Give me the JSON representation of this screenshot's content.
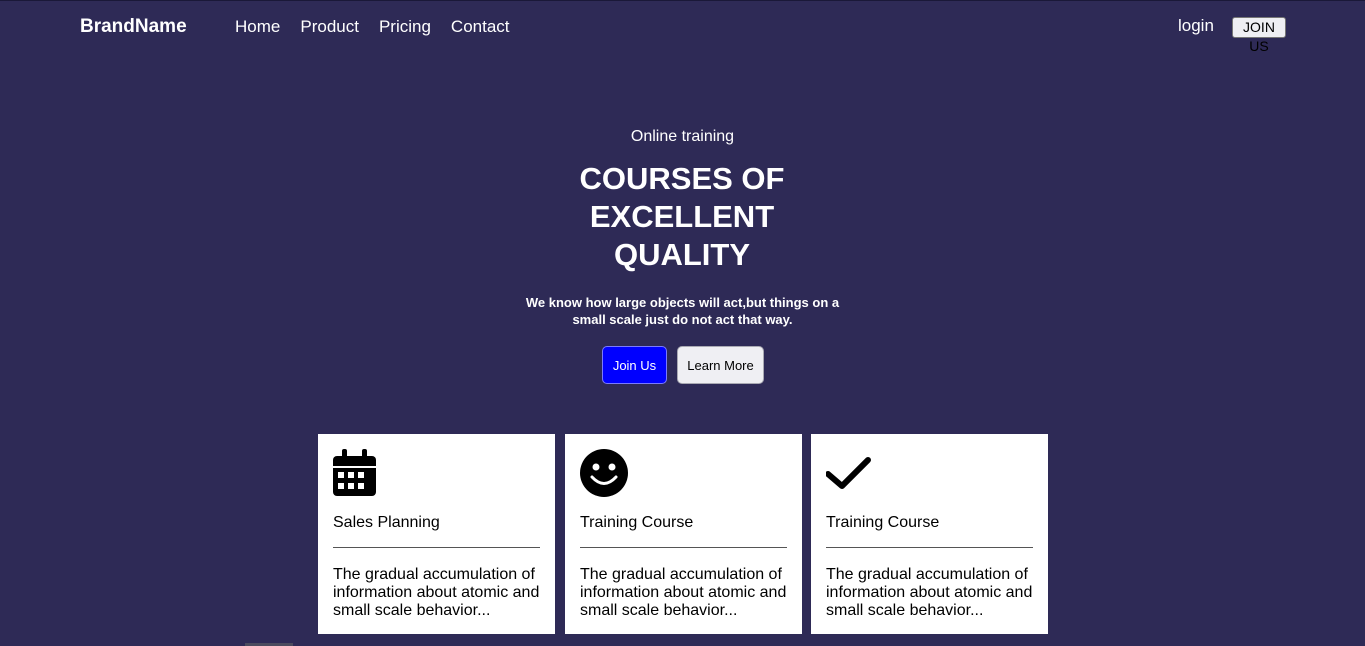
{
  "nav": {
    "brand": "BrandName",
    "links": [
      "Home",
      "Product",
      "Pricing",
      "Contact"
    ],
    "login": "login",
    "join": "JOIN US"
  },
  "hero": {
    "eyebrow": "Online training",
    "headline": "COURSES OF EXCELLENT QUALITY",
    "subtext": "We know how large objects will act,but things on a small scale just do not act that way.",
    "primary_button": "Join Us",
    "secondary_button": "Learn More"
  },
  "cards": [
    {
      "icon": "calendar-icon",
      "title": "Sales Planning",
      "desc": "The gradual accumulation of information about atomic and small scale behavior..."
    },
    {
      "icon": "smiley-icon",
      "title": "Training Course",
      "desc": "The gradual accumulation of information about atomic and small scale behavior..."
    },
    {
      "icon": "check-icon",
      "title": "Training Course",
      "desc": "The gradual accumulation of information about atomic and small scale behavior..."
    }
  ],
  "colors": {
    "background": "#2e2a56",
    "primary_button": "#0000ff",
    "card": "#ffffff"
  }
}
